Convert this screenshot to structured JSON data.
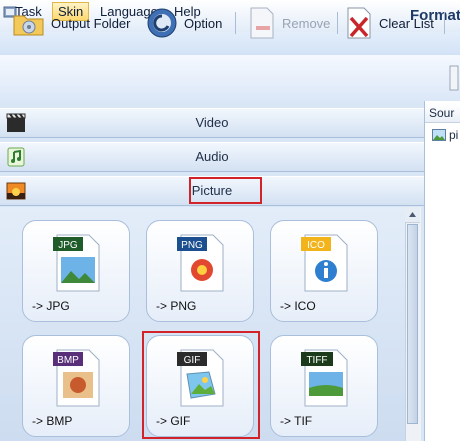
{
  "window": {
    "title": "FormatF"
  },
  "menu": {
    "items": [
      "Task",
      "Skin",
      "Language",
      "Help"
    ],
    "active": "Skin"
  },
  "toolbar": {
    "output_folder": "Output Folder",
    "option": "Option",
    "remove": "Remove",
    "clear_list": "Clear List"
  },
  "categories": {
    "video": "Video",
    "audio": "Audio",
    "picture": "Picture"
  },
  "tiles": [
    {
      "badge": "JPG",
      "label": "-> JPG"
    },
    {
      "badge": "PNG",
      "label": "-> PNG"
    },
    {
      "badge": "ICO",
      "label": "-> ICO"
    },
    {
      "badge": "BMP",
      "label": "-> BMP"
    },
    {
      "badge": "GIF",
      "label": "-> GIF"
    },
    {
      "badge": "TIFF",
      "label": "-> TIF"
    }
  ],
  "right_panel": {
    "header": "Sour",
    "item": "pi"
  },
  "colors": {
    "highlight": "#d2232a",
    "menu_active": "#ffd86f"
  }
}
